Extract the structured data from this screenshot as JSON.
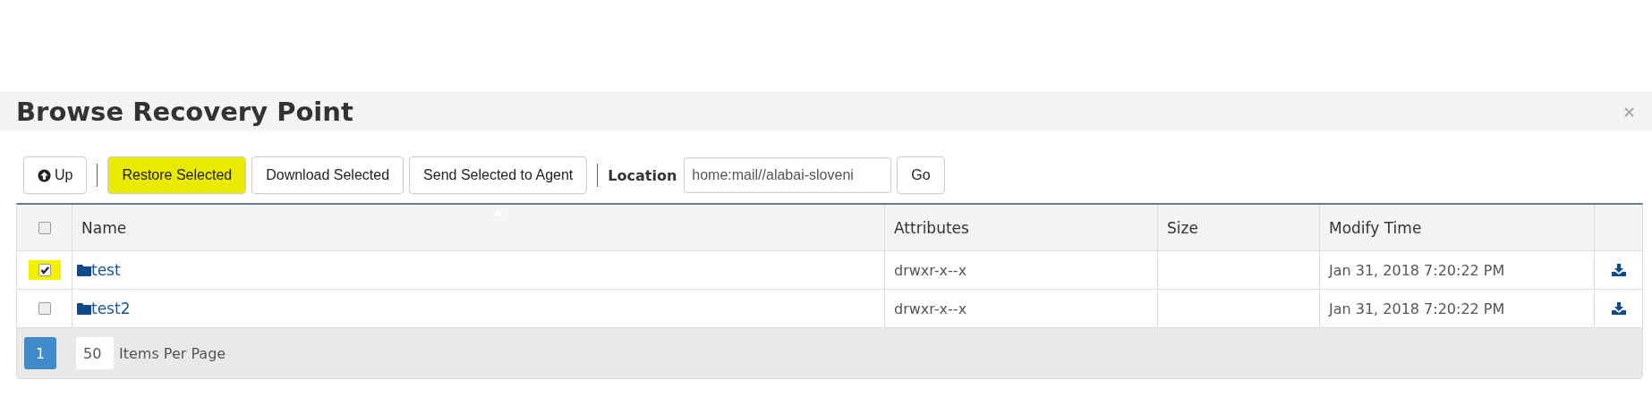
{
  "dialog": {
    "title": "Browse Recovery Point",
    "close": "×"
  },
  "toolbar": {
    "buttons": [
      {
        "kind": "icon",
        "label": "Up",
        "highlighted": false
      },
      {
        "kind": "plain",
        "label": "Restore Selected",
        "highlighted": true
      },
      {
        "kind": "plain",
        "label": "Download Selected",
        "highlighted": false
      },
      {
        "kind": "plain",
        "label": "Send Selected to Agent",
        "highlighted": false
      }
    ],
    "location_label": "Location",
    "location_value": "home:mail//alabai-sloveni",
    "go": "Go"
  },
  "table": {
    "select_all": {
      "checked": false
    },
    "columns": [
      "Name",
      "Attributes",
      "Size",
      "Modify Time"
    ],
    "rows": [
      {
        "checked": true,
        "highlighted": true,
        "name": "test",
        "attributes": "drwxr-x--x",
        "size": "",
        "modify_time": "Jan 31, 2018 7:20:22 PM"
      },
      {
        "checked": false,
        "highlighted": false,
        "name": "test2",
        "attributes": "drwxr-x--x",
        "size": "",
        "modify_time": "Jan 31, 2018 7:20:22 PM"
      }
    ]
  },
  "pager": {
    "pages": [
      {
        "label": "1",
        "selected": true
      }
    ],
    "per_page": "50",
    "per_page_label": "Items Per Page"
  }
}
